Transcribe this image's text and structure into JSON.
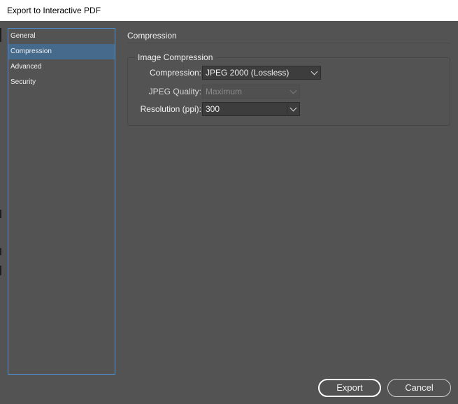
{
  "window": {
    "title": "Export to Interactive PDF"
  },
  "sidebar": {
    "items": [
      {
        "label": "General"
      },
      {
        "label": "Compression"
      },
      {
        "label": "Advanced"
      },
      {
        "label": "Security"
      }
    ]
  },
  "content": {
    "section_title": "Compression",
    "group_title": "Image Compression",
    "compression": {
      "label": "Compression:",
      "value": "JPEG 2000 (Lossless)"
    },
    "jpeg_quality": {
      "label": "JPEG Quality:",
      "value": "Maximum"
    },
    "resolution": {
      "label": "Resolution (ppi):",
      "value": "300"
    }
  },
  "footer": {
    "export_label": "Export",
    "cancel_label": "Cancel"
  },
  "colors": {
    "panel_background": "#535353",
    "selection": "#456a8b",
    "focus_border": "#4f8fd0"
  }
}
